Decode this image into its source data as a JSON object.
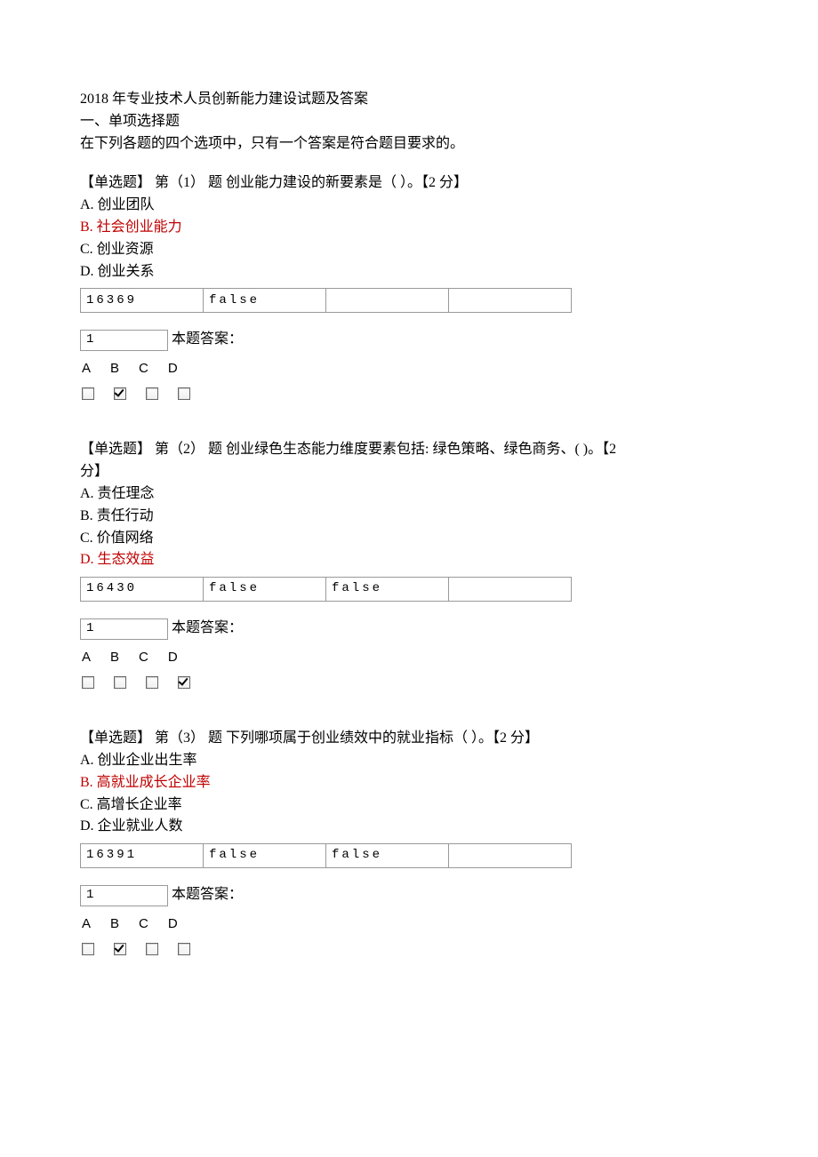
{
  "header": {
    "title": "2018 年专业技术人员创新能力建设试题及答案",
    "section": "一、单项选择题",
    "instruction": "在下列各题的四个选项中，只有一个答案是符合题目要求的。"
  },
  "answer_label": "本题答案：",
  "choice_labels": [
    "A",
    "B",
    "C",
    "D"
  ],
  "questions": [
    {
      "prompt": "【单选题】 第（1）  题  创业能力建设的新要素是（  ）。【2 分】",
      "options": [
        {
          "label": "A.  创业团队",
          "correct": false
        },
        {
          "label": "B.  社会创业能力",
          "correct": true
        },
        {
          "label": "C.  创业资源",
          "correct": false
        },
        {
          "label": "D.  创业关系",
          "correct": false
        }
      ],
      "table": [
        "16369",
        "false",
        "",
        ""
      ],
      "seq_box": "1",
      "checked": [
        false,
        true,
        false,
        false
      ]
    },
    {
      "prompt_a": "【单选题】 第（2）  题  创业绿色生态能力维度要素包括: 绿色策略、绿色商务、(   )。【2",
      "prompt_b": "分】",
      "options": [
        {
          "label": "A.  责任理念",
          "correct": false
        },
        {
          "label": "B.  责任行动",
          "correct": false
        },
        {
          "label": "C.  价值网络",
          "correct": false
        },
        {
          "label": "D.  生态效益",
          "correct": true
        }
      ],
      "table": [
        "16430",
        "false",
        "false",
        ""
      ],
      "seq_box": "1",
      "checked": [
        false,
        false,
        false,
        true
      ]
    },
    {
      "prompt": "【单选题】 第（3）  题  下列哪项属于创业绩效中的就业指标（  ）。【2 分】",
      "options": [
        {
          "label": "A.  创业企业出生率",
          "correct": false
        },
        {
          "label": "B.  高就业成长企业率",
          "correct": true
        },
        {
          "label": "C.  高增长企业率",
          "correct": false
        },
        {
          "label": "D.  企业就业人数",
          "correct": false
        }
      ],
      "table": [
        "16391",
        "false",
        "false",
        ""
      ],
      "seq_box": "1",
      "checked": [
        false,
        true,
        false,
        false
      ]
    }
  ]
}
